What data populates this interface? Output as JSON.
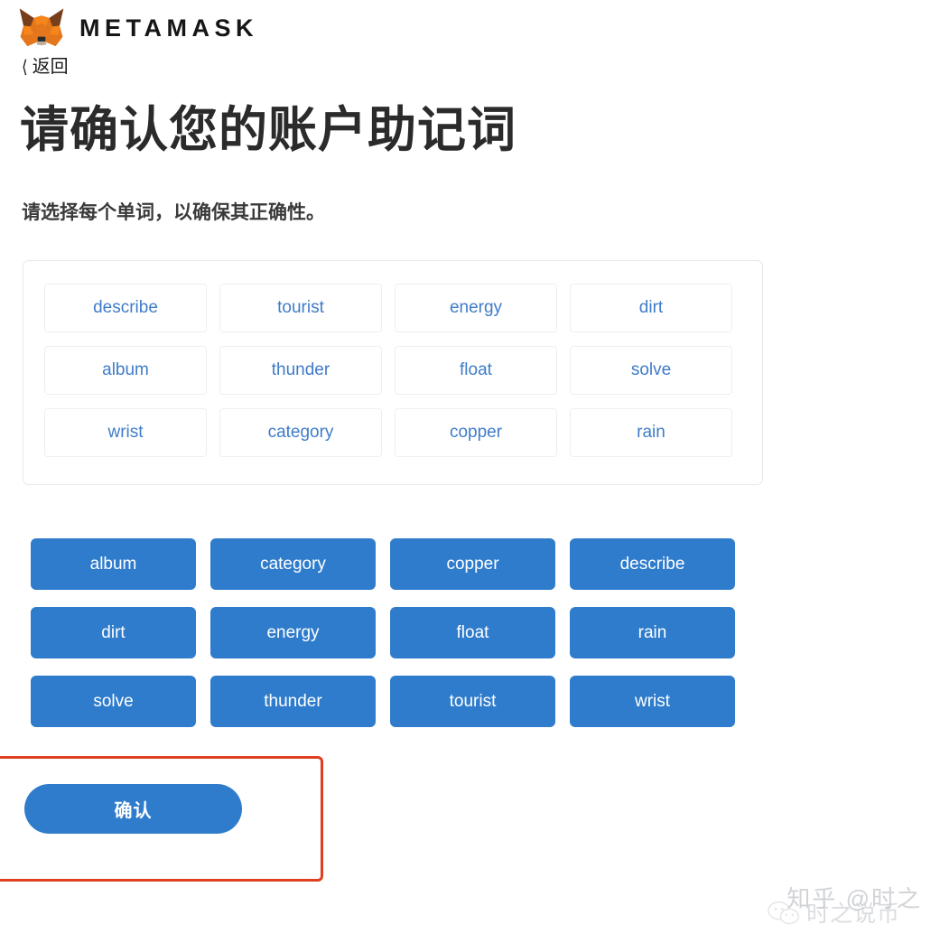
{
  "brand": {
    "wordmark": "METAMASK",
    "logo_icon": "metamask-fox-icon"
  },
  "back_link": {
    "label": "返回",
    "chevron_icon": "chevron-left-icon"
  },
  "page": {
    "title": "请确认您的账户助记词",
    "subtitle": "请选择每个单词，以确保其正确性。"
  },
  "selected_words": [
    "describe",
    "tourist",
    "energy",
    "dirt",
    "album",
    "thunder",
    "float",
    "solve",
    "wrist",
    "category",
    "copper",
    "rain"
  ],
  "word_pool": [
    "album",
    "category",
    "copper",
    "describe",
    "dirt",
    "energy",
    "float",
    "rain",
    "solve",
    "thunder",
    "tourist",
    "wrist"
  ],
  "confirm_button": {
    "label": "确认"
  },
  "annotation": {
    "highlight_color": "#e03e20",
    "target": "confirm-button"
  },
  "watermarks": {
    "zhihu": "知乎 @时之",
    "wechat": "时之说币",
    "wechat_icon": "wechat-icon"
  },
  "colors": {
    "accent_blue": "#2f7ccc",
    "chip_text_blue": "#3f7cc9",
    "annotation_red": "#e03e20",
    "fox_orange": "#e4761b",
    "fox_brown": "#763e1a"
  }
}
